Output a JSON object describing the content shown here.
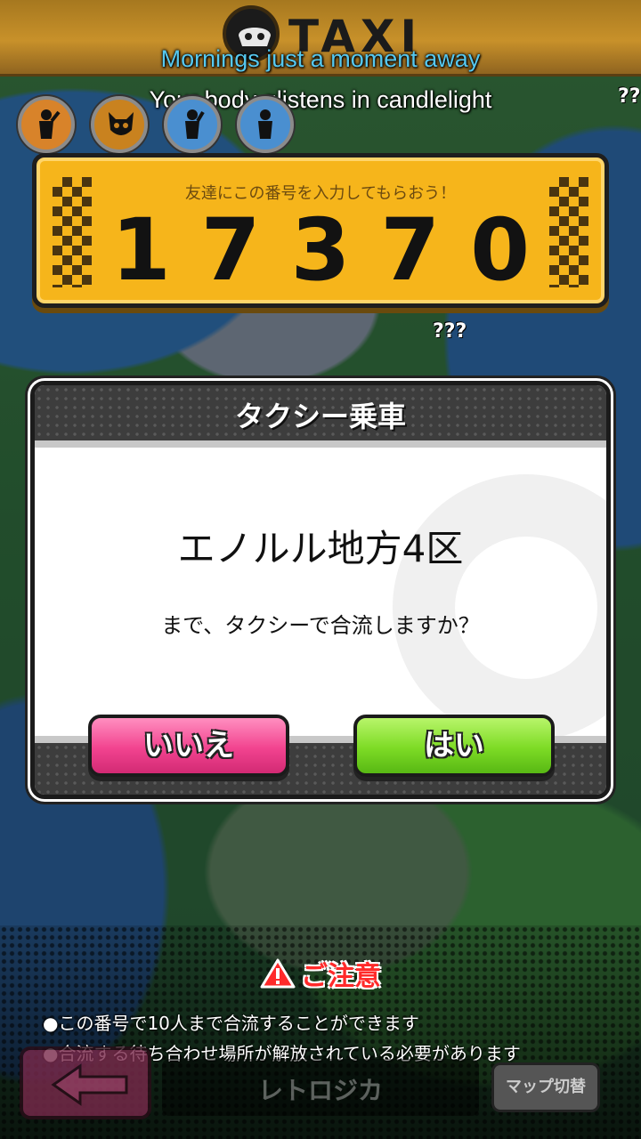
{
  "header": {
    "logo_text": "TAXI",
    "caption_line_1": "Mornings just a moment away",
    "caption_line_2": "Your body glistens in candlelight"
  },
  "party": {
    "slots": [
      {
        "name": "party-member-1",
        "color": "#d8832a"
      },
      {
        "name": "party-member-2",
        "color": "#c9821f"
      },
      {
        "name": "party-member-3",
        "color": "#4a8fd0"
      },
      {
        "name": "party-member-4",
        "color": "#4a8fd0"
      }
    ]
  },
  "map_labels": {
    "unknown_top": "??",
    "unknown_mid": "???"
  },
  "plate": {
    "hint": "友達にこの番号を入力してもらおう！",
    "number": "17370"
  },
  "dialog": {
    "title": "タクシー乗車",
    "destination": "エノルル地方4区",
    "question": "まで、タクシーで合流しますか？",
    "no_label": "いいえ",
    "yes_label": "はい"
  },
  "notice": {
    "title": "ご注意",
    "line_1": "●この番号で10人まで合流することができます",
    "line_2": "●合流する待ち合わせ場所が解放されている必要があります"
  },
  "nav": {
    "location": "レトロジカ",
    "map_switch": "マップ切替"
  },
  "colors": {
    "plate": "#f6b51b",
    "no_button": "#f2438f",
    "yes_button": "#7ddb25",
    "caption_blue": "#56c8ef",
    "notice_red": "#ff2a2a"
  }
}
